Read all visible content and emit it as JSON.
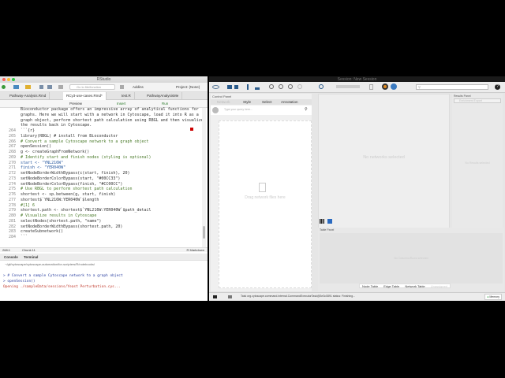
{
  "rstudio": {
    "title": "RStudio",
    "goto_placeholder": "Go to file/function",
    "addins": "Addins",
    "project": "Project: (None)",
    "tabs": [
      "Pathway-Analysis.Rmd",
      "RCy3-use-cases.Rmd*",
      "test.R",
      "PathwayAnalysisMe"
    ],
    "editor_toolbar": {
      "preview": "Preview",
      "insert": "Insert",
      "run": "Run"
    },
    "prose": [
      "Bioconductor package offers an impressive array of analytical functions for",
      "graphs. Here we will start with a network in Cytoscape, load it into R as a",
      "graph object, perform shortest path calculation using RBGL and then visualize",
      "the results back in Cytoscape."
    ],
    "code_lines": [
      {
        "n": "264",
        "t": "```{r}",
        "c": "fn"
      },
      {
        "n": "265",
        "t": "library(RBGL) # install from Bioconductor",
        "c": "fn"
      },
      {
        "n": "266",
        "t": "# Convert a sample Cytoscape network to a graph object",
        "c": "cm"
      },
      {
        "n": "267",
        "t": "openSession()",
        "c": "fn"
      },
      {
        "n": "268",
        "t": "g <- createGraphFromNetwork()",
        "c": "fn"
      },
      {
        "n": "269",
        "t": "# Identify start and finish nodes (styling is optional)",
        "c": "cm"
      },
      {
        "n": "270",
        "t": "start <- \"YNL216W\"",
        "c": "st"
      },
      {
        "n": "271",
        "t": "finish <- \"YER040W\"",
        "c": "st"
      },
      {
        "n": "272",
        "t": "setNodeBorderWidthBypass(c(start, finish), 20)",
        "c": "fn"
      },
      {
        "n": "273",
        "t": "setNodeBorderColorBypass(start, \"#00CC33\")",
        "c": "fn"
      },
      {
        "n": "274",
        "t": "setNodeBorderColorBypass(finish, \"#CC00CC\")",
        "c": "fn"
      },
      {
        "n": "275",
        "t": "# Use RBGL to perform shortest path calculation",
        "c": "cm"
      },
      {
        "n": "276",
        "t": "shortest <- sp.between(g, start, finish)",
        "c": "fn"
      },
      {
        "n": "277",
        "t": "shortest$`YNL216W:YER040W`$length",
        "c": "fn"
      },
      {
        "n": "278",
        "t": "#[1] 6",
        "c": "cm"
      },
      {
        "n": "279",
        "t": "shortest.path <- shortest$`YNL216W:YER040W`$path_detail",
        "c": "fn"
      },
      {
        "n": "280",
        "t": "# Visualize results in Cytoscape",
        "c": "cm"
      },
      {
        "n": "281",
        "t": "selectNodes(shortest.path, \"name\")",
        "c": "fn"
      },
      {
        "n": "282",
        "t": "setNodeBorderWidthBypass(shortest.path, 20)",
        "c": "fn"
      },
      {
        "n": "283",
        "t": "createSubnetwork()",
        "c": "fn"
      },
      {
        "n": "284",
        "t": "```",
        "c": "fn"
      }
    ],
    "status": {
      "position": "268:1",
      "chunk": "Chunk 11",
      "mode": "R Markdown"
    },
    "console": {
      "tabs": [
        "Console",
        "Terminal"
      ],
      "path": "~/git/cytoscape/cytoscape-automation/for-scripters/R/notebooks/",
      "lines": [
        {
          "t": "> # Convert a sample Cytoscape network to a graph object",
          "c": "#2a3fa0"
        },
        {
          "t": "> openSession()",
          "c": "#2a3fa0"
        },
        {
          "t": "Opening ./sampleData/sessions/Yeast Perturbation.cys...",
          "c": "#c0392b"
        }
      ]
    }
  },
  "cytoscape": {
    "title": "Session: New Session",
    "control_panel": {
      "title": "Control Panel",
      "tabs": [
        "Network",
        "Style",
        "Select",
        "Annotation"
      ],
      "search_placeholder": "Type your query here...",
      "drop_hint": "Drag network files here"
    },
    "network_view": {
      "empty": "No networks selected"
    },
    "results_panel": {
      "title": "Results Panel",
      "button": "Enrichment Export",
      "empty": "No Results selected"
    },
    "table_panel": {
      "title": "Table Panel",
      "empty": "No Columns/Rows selected",
      "tabs": [
        "Node Table",
        "Edge Table",
        "Network Table",
        "Unassigned"
      ]
    },
    "status": {
      "task": "Task org.cytoscape.command.internal.CommandExecutorTask@3e3c0891 status: Finishing...",
      "memory": "Memory"
    }
  }
}
